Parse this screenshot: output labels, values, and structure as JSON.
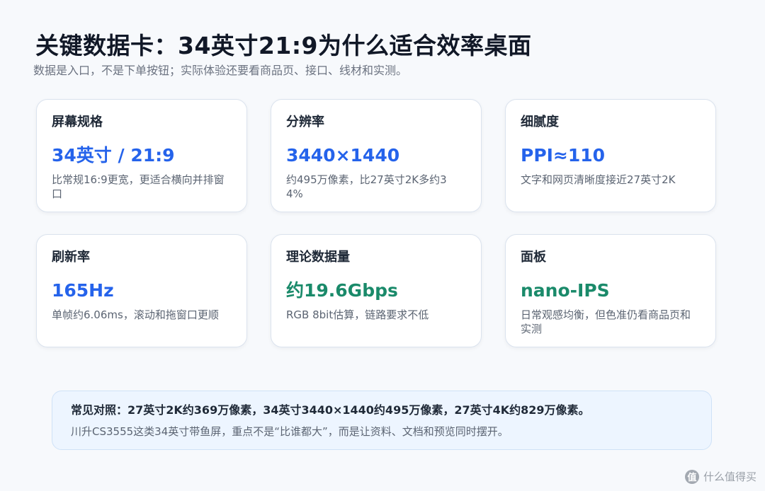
{
  "title": "关键数据卡：34英寸21:9为什么适合效率桌面",
  "subtitle": "数据是入口，不是下单按钮；实际体验还要看商品页、接口、线材和实测。",
  "colors": {
    "accent_blue": "#2563eb",
    "accent_green": "#1a8a6a",
    "card_border": "#dbe3ee",
    "note_background": "#edf5ff"
  },
  "cards": [
    {
      "label": "屏幕规格",
      "value": "34英寸 / 21:9",
      "desc": "比常规16:9更宽，更适合横向并排窗口",
      "value_color": "blue"
    },
    {
      "label": "分辨率",
      "value": "3440×1440",
      "desc": "约495万像素，比27英寸2K多约34%",
      "value_color": "blue"
    },
    {
      "label": "细腻度",
      "value": "PPI≈110",
      "desc": "文字和网页清晰度接近27英寸2K",
      "value_color": "blue"
    },
    {
      "label": "刷新率",
      "value": "165Hz",
      "desc": "单帧约6.06ms，滚动和拖窗口更顺",
      "value_color": "blue"
    },
    {
      "label": "理论数据量",
      "value": "约19.6Gbps",
      "desc": "RGB 8bit估算，链路要求不低",
      "value_color": "green"
    },
    {
      "label": "面板",
      "value": "nano-IPS",
      "desc": "日常观感均衡，但色准仍看商品页和实测",
      "value_color": "green"
    }
  ],
  "note": {
    "main": "常见对照：27英寸2K约369万像素，34英寸3440×1440约495万像素，27英寸4K约829万像素。",
    "sub": "川升CS3555这类34英寸带鱼屏，重点不是“比谁都大”，而是让资料、文档和预览同时摆开。"
  },
  "watermark": {
    "icon": "zhi-logo-icon",
    "icon_glyph": "值",
    "text": "什么值得买"
  }
}
